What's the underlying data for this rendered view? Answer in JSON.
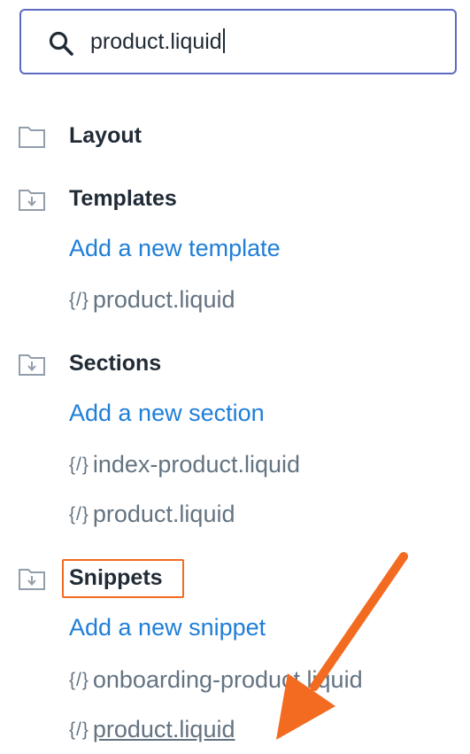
{
  "search": {
    "value": "product.liquid"
  },
  "folders": [
    {
      "name": "Layout"
    },
    {
      "name": "Templates",
      "add_label": "Add a new template",
      "files": [
        "product.liquid"
      ]
    },
    {
      "name": "Sections",
      "add_label": "Add a new section",
      "files": [
        "index-product.liquid",
        "product.liquid"
      ]
    },
    {
      "name": "Snippets",
      "add_label": "Add a new snippet",
      "files": [
        "onboarding-product.liquid",
        "product.liquid"
      ]
    }
  ],
  "file_icon_glyph": "{/}",
  "colors": {
    "link": "#1f7ed8",
    "accent_border": "#5c6ac4",
    "annotation": "#f26b21",
    "muted": "#637381"
  }
}
